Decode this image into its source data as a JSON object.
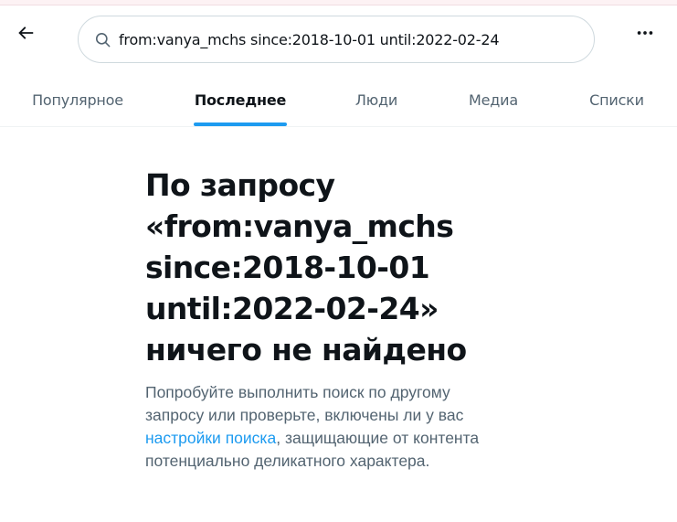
{
  "header": {
    "back_icon": "arrow-left-icon",
    "search": {
      "icon": "search-icon",
      "value": "from:vanya_mchs since:2018-10-01 until:2022-02-24",
      "placeholder": ""
    },
    "more_icon": "more-dots-icon"
  },
  "tabs": [
    {
      "label": "Популярное",
      "active": false
    },
    {
      "label": "Последнее",
      "active": true
    },
    {
      "label": "Люди",
      "active": false
    },
    {
      "label": "Медиа",
      "active": false
    },
    {
      "label": "Списки",
      "active": false
    }
  ],
  "empty_state": {
    "title_lines": [
      "По запросу",
      "«from:vanya_mchs",
      "since:2018-10-01",
      "until:2022-02-24»",
      "ничего не найдено"
    ],
    "desc_line1": "Попробуйте выполнить поиск по другому",
    "desc_line2": "запросу или проверьте, включены ли у вас",
    "desc_link": "настройки поиска",
    "desc_line3_rest": ", защищающие от контента",
    "desc_line4": "потенциально деликатного характера."
  },
  "colors": {
    "accent": "#1d9bf0",
    "text_primary": "#0f1419",
    "text_secondary": "#536471",
    "border": "#cfd9de"
  }
}
